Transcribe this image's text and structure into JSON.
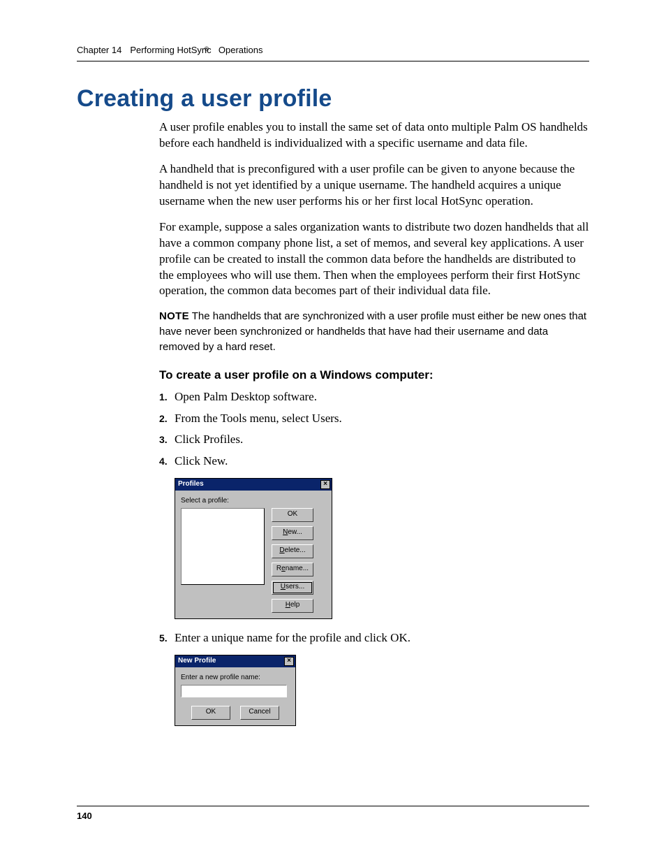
{
  "chapter": "Chapter 14",
  "chapter_title_pre": "Performing HotSync",
  "chapter_title_post": " Operations",
  "reg_mark": "®",
  "title": "Creating a user profile",
  "para1": "A user profile enables you to install the same set of data onto multiple Palm OS handhelds before each handheld is individualized with a specific username and data file.",
  "para2": "A handheld that is preconfigured with a user profile can be given to anyone because the handheld is not yet identified by a unique username. The handheld acquires a unique username when the new user performs his or her first local HotSync operation.",
  "para3": "For example, suppose a sales organization wants to distribute two dozen handhelds that all have a common company phone list, a set of memos, and several key applications. A user profile can be created to install the common data before the handhelds are distributed to the employees who will use them. Then when the employees perform their first HotSync operation, the common data becomes part of their individual data file.",
  "note_label": "NOTE",
  "note_text": "  The handhelds that are synchronized with a user profile must either be new ones that have never been synchronized or handhelds that have had their username and data removed by a hard reset.",
  "subhead": "To create a user profile on a Windows computer:",
  "steps": [
    "Open Palm Desktop software.",
    "From the Tools menu, select Users.",
    "Click Profiles.",
    "Click New.",
    "Enter a unique name for the profile and click OK."
  ],
  "dlg1": {
    "title": "Profiles",
    "label": "Select a profile:",
    "buttons": [
      "OK",
      "New...",
      "Delete...",
      "Rename...",
      "Users...",
      "Help"
    ]
  },
  "dlg2": {
    "title": "New Profile",
    "label": "Enter a new profile name:",
    "ok": "OK",
    "cancel": "Cancel"
  },
  "page_number": "140"
}
